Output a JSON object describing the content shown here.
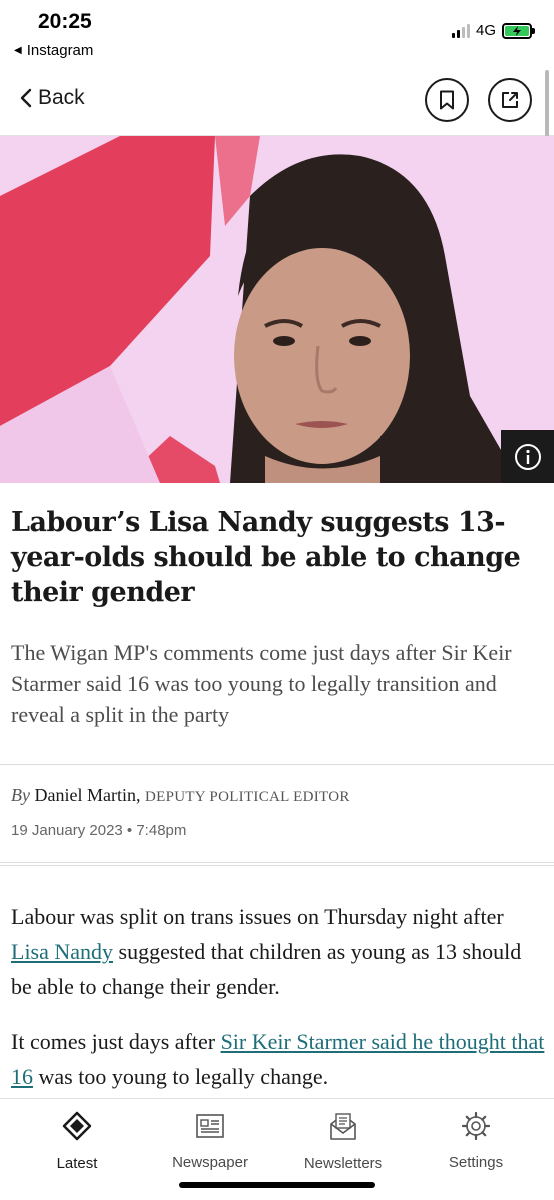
{
  "status_bar": {
    "time": "20:25",
    "back_app": "Instagram",
    "network": "4G",
    "battery_color": "#34c759"
  },
  "nav": {
    "back_label": "Back",
    "bookmark_icon": "bookmark-icon",
    "share_icon": "share-icon"
  },
  "hero": {
    "info_icon": "info-icon",
    "background_color": "#f2d0ef",
    "accent_color": "#e2314f"
  },
  "article": {
    "headline": "Labour’s Lisa Nandy suggests 13-year-olds should be able to change their gender",
    "standfirst": "The Wigan MP's comments come just days after Sir Keir Starmer said 16 was too young to legally transition and reveal a split in the party",
    "byline": {
      "by": "By",
      "author": "Daniel Martin,",
      "role": "DEPUTY POLITICAL EDITOR"
    },
    "date": "19 January 2023 • 7:48pm",
    "paragraphs": [
      {
        "before": "Labour was split on trans issues on Thursday night after ",
        "link": "Lisa Nandy",
        "after": " suggested that children as young as 13 should be able to change their gender."
      },
      {
        "before": "It comes just days after ",
        "link": "Sir Keir Starmer said he thought that 16",
        "after": " was too young to legally change."
      }
    ],
    "link_color": "#1d6e79"
  },
  "tabs": [
    {
      "label": "Latest",
      "icon": "latest-icon",
      "active": true
    },
    {
      "label": "Newspaper",
      "icon": "newspaper-icon",
      "active": false
    },
    {
      "label": "Newsletters",
      "icon": "newsletters-icon",
      "active": false
    },
    {
      "label": "Settings",
      "icon": "settings-icon",
      "active": false
    }
  ]
}
